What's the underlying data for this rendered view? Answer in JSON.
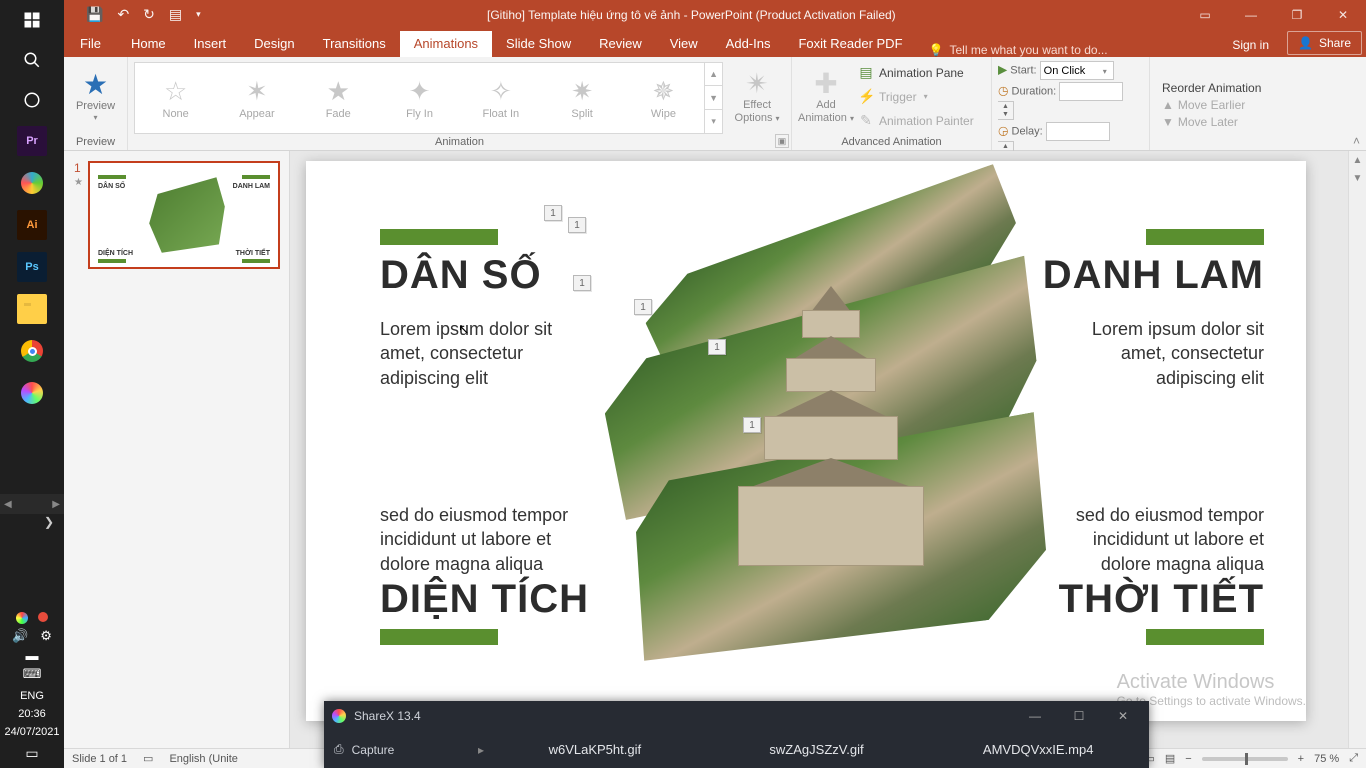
{
  "titlebar": {
    "title": "[Gitiho] Template hiệu ứng tô vẽ ảnh - PowerPoint (Product Activation Failed)"
  },
  "tabs": {
    "file": "File",
    "items": [
      "Home",
      "Insert",
      "Design",
      "Transitions",
      "Animations",
      "Slide Show",
      "Review",
      "View",
      "Add-Ins",
      "Foxit Reader PDF"
    ],
    "active_index": 4,
    "tell_me": "Tell me what you want to do...",
    "sign_in": "Sign in",
    "share": "Share"
  },
  "ribbon": {
    "preview": {
      "label": "Preview",
      "group": "Preview"
    },
    "animation_group": "Animation",
    "effects": [
      "None",
      "Appear",
      "Fade",
      "Fly In",
      "Float In",
      "Split",
      "Wipe"
    ],
    "effect_options": {
      "line1": "Effect",
      "line2": "Options"
    },
    "advanced_group": "Advanced Animation",
    "add_animation": {
      "line1": "Add",
      "line2": "Animation"
    },
    "adv": {
      "pane": "Animation Pane",
      "trigger": "Trigger",
      "painter": "Animation Painter"
    },
    "timing_group": "Timing",
    "timing": {
      "start_lbl": "Start:",
      "start_val": "On Click",
      "duration_lbl": "Duration:",
      "duration_val": "",
      "delay_lbl": "Delay:",
      "delay_val": ""
    },
    "reorder": {
      "header": "Reorder Animation",
      "earlier": "Move Earlier",
      "later": "Move Later"
    }
  },
  "thumb": {
    "number": "1"
  },
  "slide": {
    "top_left_heading": "DÂN SỐ",
    "top_left_body": "Lorem ipsum dolor sit amet, consectetur adipiscing elit",
    "bottom_left_body": "sed do eiusmod tempor incididunt ut labore et dolore magna aliqua",
    "bottom_left_heading": "DIỆN TÍCH",
    "top_right_heading": "DANH LAM",
    "top_right_body": "Lorem ipsum dolor sit amet, consectetur adipiscing elit",
    "bottom_right_body": "sed do eiusmod tempor incididunt ut labore et dolore magna aliqua",
    "bottom_right_heading": "THỜI TIẾT",
    "anim_tags": [
      "1",
      "1",
      "1",
      "1",
      "1",
      "1"
    ],
    "mini": {
      "tl": "DÂN SỐ",
      "tr": "DANH LAM",
      "bl": "DIỆN TÍCH",
      "br": "THỜI TIẾT"
    }
  },
  "watermark": {
    "heading": "Activate Windows",
    "sub": "Go to Settings to activate Windows."
  },
  "statusbar": {
    "slide": "Slide 1 of 1",
    "lang": "English (Unite",
    "zoom": "75 %"
  },
  "sharex": {
    "title": "ShareX 13.4",
    "menu": "Capture",
    "files": [
      "w6VLaKP5ht.gif",
      "swZAgJSZzV.gif",
      "AMVDQVxxIE.mp4"
    ]
  },
  "win": {
    "time": "20:36",
    "date": "24/07/2021",
    "lang": "ENG"
  }
}
